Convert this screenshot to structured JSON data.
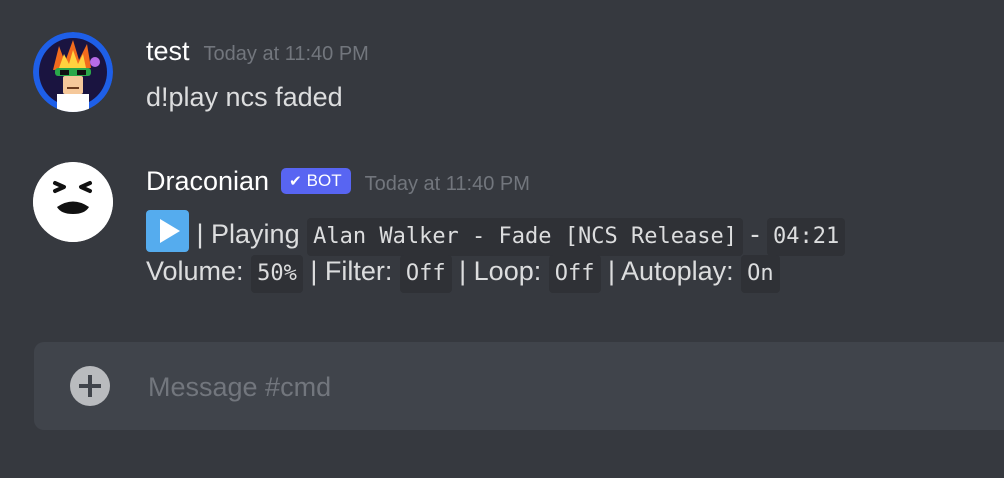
{
  "messages": [
    {
      "username": "test",
      "timestamp": "Today at 11:40 PM",
      "text": "d!play ncs faded"
    },
    {
      "username": "Draconian",
      "bot_tag": "BOT",
      "timestamp": "Today at 11:40 PM",
      "line1": {
        "icon": "arrow-forward-icon",
        "playing_label": "| Playing",
        "track": "Alan Walker - Fade [NCS Release]",
        "separator": "-",
        "duration": "04:21"
      },
      "line2": {
        "volume_label": "Volume:",
        "volume_value": "50%",
        "filter_label": "| Filter:",
        "filter_value": "Off",
        "loop_label": "| Loop:",
        "loop_value": "Off",
        "autoplay_label": "| Autoplay:",
        "autoplay_value": "On"
      }
    }
  ],
  "composer": {
    "placeholder": "Message #cmd"
  },
  "colors": {
    "background": "#36393f",
    "bot_tag": "#5865f2",
    "timestamp": "#72767d",
    "code_bg": "#2f3136"
  }
}
